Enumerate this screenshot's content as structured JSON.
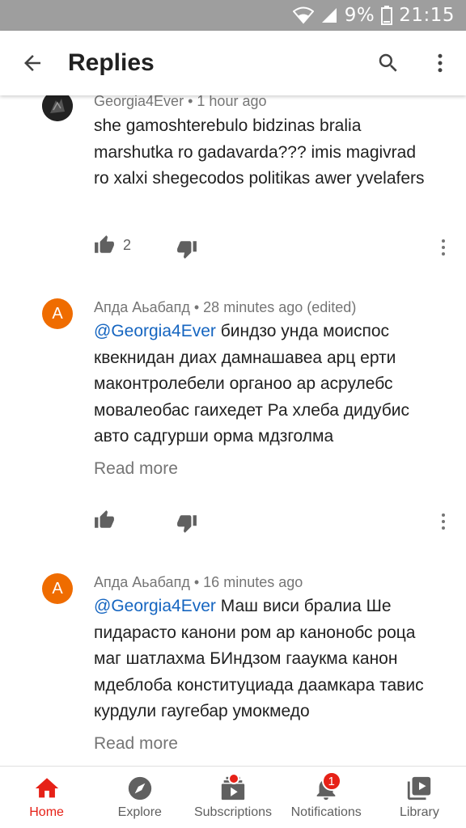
{
  "status_bar": {
    "battery_percent": "9%",
    "time": "21:15",
    "icons": [
      "wifi-icon",
      "signal-icon",
      "battery-icon"
    ]
  },
  "app_bar": {
    "title": "Replies",
    "icons": [
      "back-arrow-icon",
      "search-icon",
      "more-vert-icon"
    ]
  },
  "comments": [
    {
      "author": "Georgia4Ever",
      "time": "1 hour ago",
      "edited": "",
      "mention": "",
      "text": "she gamoshterebulo bidzinas bralia marshutka ro gadavarda??? imis magivrad ro xalxi shegecodos politikas awer yvelafers",
      "likes": "2",
      "read_more": ""
    },
    {
      "author": "Апда Аьабапд",
      "avatar_letter": "A",
      "time": "28 minutes ago",
      "edited": "(edited)",
      "mention": "@Georgia4Ever",
      "text": "биндзо унда моиспос квекнидан диах дамнашавеа арц ерти маконтролебели органоо ар асрулебс мовалеобас гаихедет Ра хлеба дидубис авто садгурши орма мдзголма",
      "likes": "",
      "read_more": "Read more"
    },
    {
      "author": "Апда Аьабапд",
      "avatar_letter": "A",
      "time": "16 minutes ago",
      "edited": "",
      "mention": "@Georgia4Ever",
      "text": "Маш виси бралиа Ше пидарасто канони ром ар канонобс роца маг шатлахма БИндзом гааукма канон мдеблоба конституциада даамкара тавис курдули гаугебар умокмедо",
      "likes": "",
      "read_more": "Read more"
    }
  ],
  "separator": "•",
  "bottom_nav": [
    {
      "label": "Home",
      "icon": "home-icon",
      "active": true
    },
    {
      "label": "Explore",
      "icon": "compass-icon",
      "active": false
    },
    {
      "label": "Subscriptions",
      "icon": "subscriptions-icon",
      "active": false,
      "dot": true
    },
    {
      "label": "Notifications",
      "icon": "bell-icon",
      "active": false,
      "badge": "1"
    },
    {
      "label": "Library",
      "icon": "library-icon",
      "active": false
    }
  ],
  "colors": {
    "accent_red": "#e62117",
    "mention_blue": "#1565c0",
    "avatar_orange": "#ef6c00",
    "status_bar_gray": "#9e9e9e"
  }
}
